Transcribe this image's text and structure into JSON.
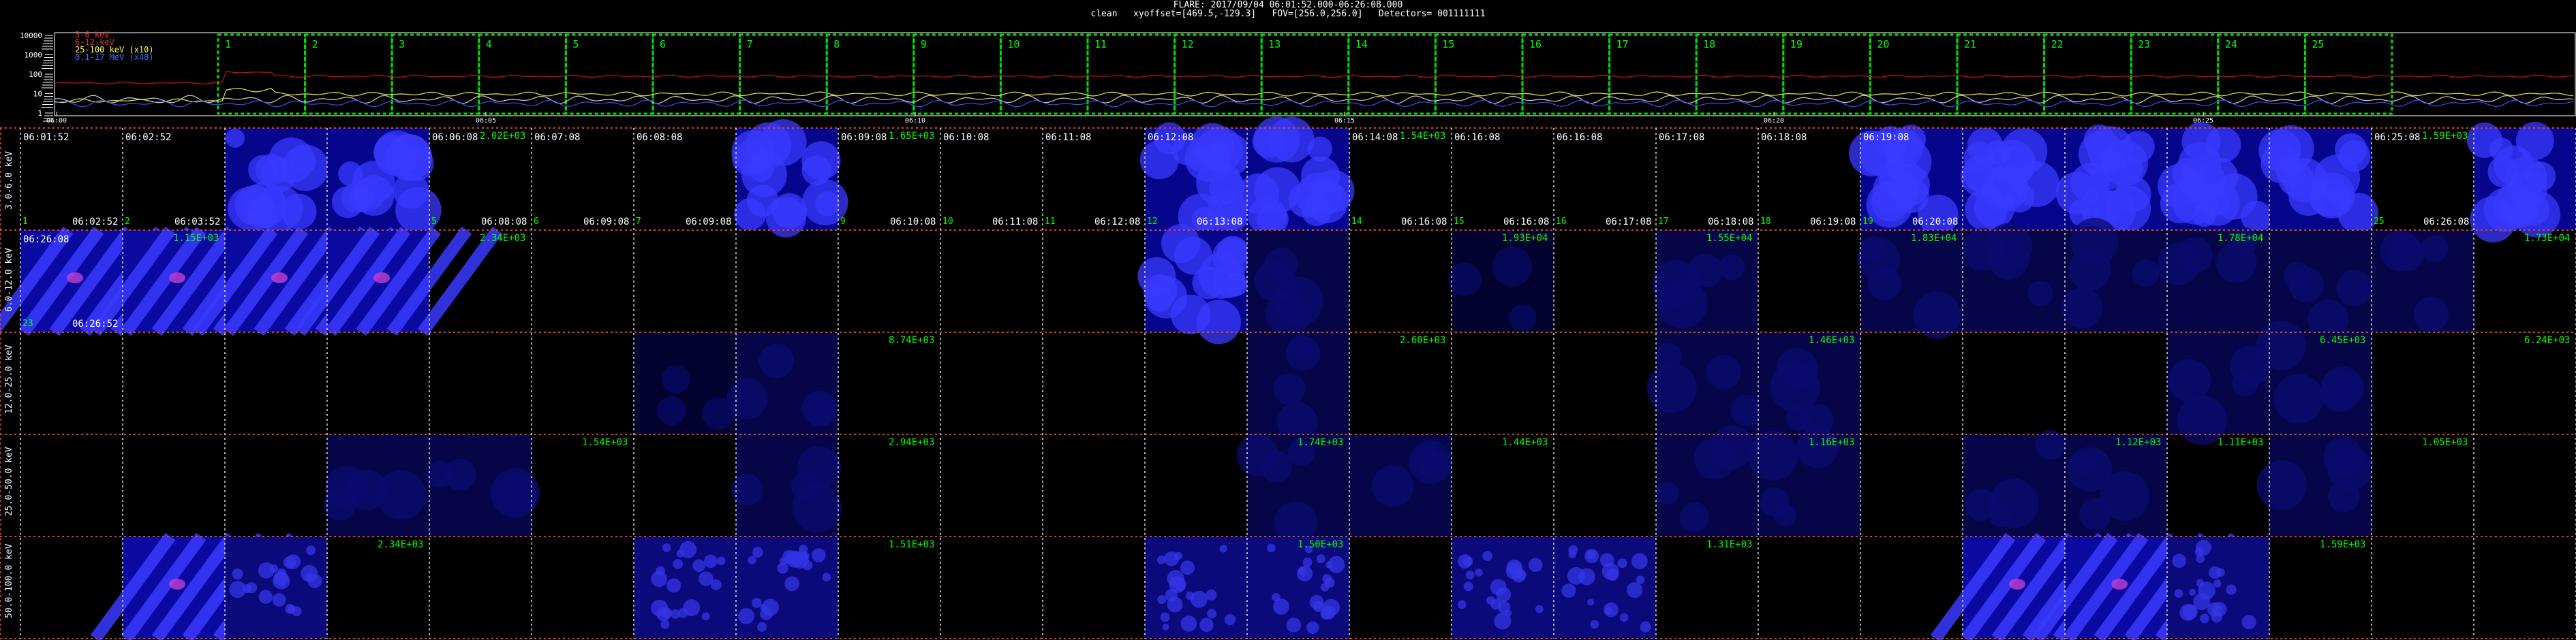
{
  "header": {
    "title": "FLARE: 2017/09/04 06:01:52.000-06:26:08.000",
    "info": "clean   xyoffset=[469.5,-129.3]   FOV=[256.0,256.0]   Detectors= 001111111"
  },
  "lightcurve": {
    "legend": [
      {
        "label": "3-6 keV",
        "color": "#ff3030"
      },
      {
        "label": "6-12 keV",
        "color": "#cc3a3a"
      },
      {
        "label": "25-100 keV (x10)",
        "color": "#ffff40"
      },
      {
        "label": "0.1-17 MeV (x48)",
        "color": "#3b6fff"
      }
    ],
    "y_ticks": [
      "10000",
      "1000",
      "100",
      "10",
      "1"
    ],
    "x_ticks": [
      "06:00",
      "06:05",
      "06:10",
      "06:15",
      "06:20",
      "06:25"
    ],
    "intervals": [
      "1",
      "2",
      "3",
      "4",
      "5",
      "6",
      "7",
      "8",
      "9",
      "10",
      "11",
      "12",
      "13",
      "14",
      "15",
      "16",
      "17",
      "18",
      "19",
      "20",
      "21",
      "22",
      "23",
      "24",
      "25"
    ],
    "colors": {
      "interval_box": "#00e000",
      "curve_red": "#d01010",
      "curve_yellow": "#e8e840",
      "curve_white": "#cccccc",
      "curve_blue": "#3050ff"
    }
  },
  "bands": [
    "3.0-6.0 keV",
    "6.0-12.0 keV",
    "12.0-25.0 keV",
    "25.0-50.0 keV",
    "50.0-100.0 keV"
  ],
  "cell_time_labels": [
    {
      "col": 0,
      "top": "06:01:52",
      "bottom": "06:02:52",
      "num": "1"
    },
    {
      "col": 1,
      "top": "06:02:52",
      "bottom": "06:03:52",
      "num": "2"
    },
    {
      "col": 4,
      "top": "06:06:08",
      "bottom": "06:08:08",
      "num": "5"
    },
    {
      "col": 5,
      "top": "06:07:08",
      "bottom": "06:09:08",
      "num": "6"
    },
    {
      "col": 6,
      "top": "06:08:08",
      "bottom": "06:09:08",
      "num": "7"
    },
    {
      "col": 8,
      "top": "06:09:08",
      "bottom": "06:10:08",
      "num": "9"
    },
    {
      "col": 9,
      "top": "06:10:08",
      "bottom": "06:11:08",
      "num": "10"
    },
    {
      "col": 10,
      "top": "06:11:08",
      "bottom": "06:12:08",
      "num": "11"
    },
    {
      "col": 11,
      "top": "06:12:08",
      "bottom": "06:13:08",
      "num": "12"
    },
    {
      "col": 13,
      "top": "06:14:08",
      "bottom": "06:16:08",
      "num": "14"
    },
    {
      "col": 14,
      "top": "06:16:08",
      "bottom": "06:16:08",
      "num": "15"
    },
    {
      "col": 15,
      "top": "06:16:08",
      "bottom": "06:17:08",
      "num": "16"
    },
    {
      "col": 16,
      "top": "06:17:08",
      "bottom": "06:18:08",
      "num": "17"
    },
    {
      "col": 17,
      "top": "06:18:08",
      "bottom": "06:19:08",
      "num": "18"
    },
    {
      "col": 18,
      "top": "06:19:08",
      "bottom": "06:20:08",
      "num": "19"
    },
    {
      "col": 23,
      "top": "06:25:08",
      "bottom": "06:26:08",
      "num": "25"
    }
  ],
  "row2_labels": {
    "top": "06:26:08",
    "bottom": "06:26:52",
    "num": "23"
  },
  "peak_values": [
    {
      "row": 0,
      "col": 4,
      "text": "2.02E+03"
    },
    {
      "row": 0,
      "col": 8,
      "text": "1.65E+03"
    },
    {
      "row": 0,
      "col": 13,
      "text": "1.54E+03"
    },
    {
      "row": 0,
      "col": 23,
      "text": "1.59E+03"
    },
    {
      "row": 1,
      "col": 1,
      "text": "1.15E+03"
    },
    {
      "row": 1,
      "col": 4,
      "text": "2.34E+03"
    },
    {
      "row": 1,
      "col": 14,
      "text": "1.93E+04"
    },
    {
      "row": 1,
      "col": 16,
      "text": "1.55E+04"
    },
    {
      "row": 1,
      "col": 18,
      "text": "1.83E+04"
    },
    {
      "row": 1,
      "col": 21,
      "text": "1.78E+04"
    },
    {
      "row": 1,
      "col": 24,
      "text": "1.73E+04"
    },
    {
      "row": 2,
      "col": 8,
      "text": "8.74E+03"
    },
    {
      "row": 2,
      "col": 13,
      "text": "2.60E+03"
    },
    {
      "row": 2,
      "col": 17,
      "text": "1.46E+03"
    },
    {
      "row": 2,
      "col": 22,
      "text": "6.45E+03"
    },
    {
      "row": 2,
      "col": 24,
      "text": "6.24E+03"
    },
    {
      "row": 3,
      "col": 5,
      "text": "1.54E+03"
    },
    {
      "row": 3,
      "col": 8,
      "text": "2.94E+03"
    },
    {
      "row": 3,
      "col": 12,
      "text": "1.74E+03"
    },
    {
      "row": 3,
      "col": 14,
      "text": "1.44E+03"
    },
    {
      "row": 3,
      "col": 17,
      "text": "1.16E+03"
    },
    {
      "row": 3,
      "col": 20,
      "text": "1.12E+03"
    },
    {
      "row": 3,
      "col": 21,
      "text": "1.11E+03"
    },
    {
      "row": 3,
      "col": 23,
      "text": "1.05E+03"
    },
    {
      "row": 4,
      "col": 3,
      "text": "2.34E+03"
    },
    {
      "row": 4,
      "col": 8,
      "text": "1.51E+03"
    },
    {
      "row": 4,
      "col": 12,
      "text": "1.50E+03"
    },
    {
      "row": 4,
      "col": 16,
      "text": "1.31E+03"
    },
    {
      "row": 4,
      "col": 22,
      "text": "1.59E+03"
    }
  ],
  "images": [
    {
      "row": 0,
      "col": 2,
      "kind": "blob"
    },
    {
      "row": 0,
      "col": 3,
      "kind": "blob"
    },
    {
      "row": 0,
      "col": 7,
      "kind": "blob"
    },
    {
      "row": 0,
      "col": 11,
      "kind": "blob"
    },
    {
      "row": 0,
      "col": 12,
      "kind": "blob"
    },
    {
      "row": 0,
      "col": 18,
      "kind": "blob"
    },
    {
      "row": 0,
      "col": 19,
      "kind": "blob"
    },
    {
      "row": 0,
      "col": 20,
      "kind": "blob"
    },
    {
      "row": 0,
      "col": 21,
      "kind": "blob"
    },
    {
      "row": 0,
      "col": 22,
      "kind": "blob"
    },
    {
      "row": 0,
      "col": 24,
      "kind": "blob"
    },
    {
      "row": 1,
      "col": 0,
      "kind": "streak"
    },
    {
      "row": 1,
      "col": 1,
      "kind": "streak"
    },
    {
      "row": 1,
      "col": 2,
      "kind": "streak"
    },
    {
      "row": 1,
      "col": 3,
      "kind": "streak"
    },
    {
      "row": 1,
      "col": 11,
      "kind": "blob"
    },
    {
      "row": 1,
      "col": 12,
      "kind": "dim"
    },
    {
      "row": 1,
      "col": 14,
      "kind": "faint"
    },
    {
      "row": 1,
      "col": 16,
      "kind": "dim"
    },
    {
      "row": 1,
      "col": 18,
      "kind": "dim"
    },
    {
      "row": 1,
      "col": 19,
      "kind": "dim"
    },
    {
      "row": 1,
      "col": 20,
      "kind": "dim"
    },
    {
      "row": 1,
      "col": 21,
      "kind": "dim"
    },
    {
      "row": 1,
      "col": 22,
      "kind": "dim"
    },
    {
      "row": 1,
      "col": 23,
      "kind": "dim"
    },
    {
      "row": 2,
      "col": 6,
      "kind": "faint"
    },
    {
      "row": 2,
      "col": 7,
      "kind": "dim"
    },
    {
      "row": 2,
      "col": 12,
      "kind": "dim"
    },
    {
      "row": 2,
      "col": 16,
      "kind": "dim"
    },
    {
      "row": 2,
      "col": 17,
      "kind": "dim"
    },
    {
      "row": 2,
      "col": 21,
      "kind": "dim"
    },
    {
      "row": 2,
      "col": 22,
      "kind": "dim"
    },
    {
      "row": 3,
      "col": 3,
      "kind": "dim"
    },
    {
      "row": 3,
      "col": 4,
      "kind": "dim"
    },
    {
      "row": 3,
      "col": 7,
      "kind": "dim"
    },
    {
      "row": 3,
      "col": 12,
      "kind": "dim"
    },
    {
      "row": 3,
      "col": 13,
      "kind": "dim"
    },
    {
      "row": 3,
      "col": 16,
      "kind": "dim"
    },
    {
      "row": 3,
      "col": 17,
      "kind": "dim"
    },
    {
      "row": 3,
      "col": 19,
      "kind": "dim"
    },
    {
      "row": 3,
      "col": 20,
      "kind": "dim"
    },
    {
      "row": 3,
      "col": 22,
      "kind": "dim"
    },
    {
      "row": 4,
      "col": 1,
      "kind": "streak"
    },
    {
      "row": 4,
      "col": 2,
      "kind": "speckle"
    },
    {
      "row": 4,
      "col": 6,
      "kind": "speckle"
    },
    {
      "row": 4,
      "col": 7,
      "kind": "speckle"
    },
    {
      "row": 4,
      "col": 11,
      "kind": "speckle"
    },
    {
      "row": 4,
      "col": 12,
      "kind": "speckle"
    },
    {
      "row": 4,
      "col": 14,
      "kind": "speckle"
    },
    {
      "row": 4,
      "col": 15,
      "kind": "speckle"
    },
    {
      "row": 4,
      "col": 19,
      "kind": "streak"
    },
    {
      "row": 4,
      "col": 20,
      "kind": "streak"
    },
    {
      "row": 4,
      "col": 21,
      "kind": "speckle"
    }
  ]
}
